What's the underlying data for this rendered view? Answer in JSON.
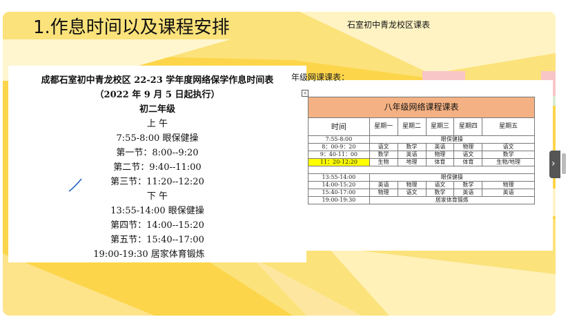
{
  "slide": {
    "title": "1.作息时间以及课程安排",
    "subtitle": "石室初中青龙校区课表"
  },
  "schedule": {
    "heading": "成都石室初中青龙校区 22-23 学年度网络保学作息时间表",
    "effective": "（2022 年 9 月 5 日起执行）",
    "grade": "初二年级",
    "morning": "上        午",
    "eye_exercise_am": "7:55-8:00 眼保健操",
    "period_1": "第一节：8:00--9:20",
    "period_2": "第二节：9:40--11:00",
    "period_3": "第三节：11:20--12:20",
    "afternoon": "下        午",
    "eye_exercise_pm": "13:55-14:00 眼保健操",
    "period_4": "第四节：14:00--15:20",
    "period_5": "第五节：15:40--17:00",
    "evening": "19:00-19:30        居家体育锻炼"
  },
  "timetable": {
    "section_label": "年级网课课表：",
    "title": "八年级网络课程课表",
    "header": [
      "时间",
      "星期一",
      "星期二",
      "星期三",
      "星期四",
      "星期五"
    ],
    "rows": [
      {
        "time": "7:55-8:00",
        "merged": "眼保健操"
      },
      {
        "time": "8：00-9：20",
        "cells": [
          "语文",
          "数学",
          "英语",
          "物理",
          "语文"
        ]
      },
      {
        "time": "9：40-11：00",
        "cells": [
          "数学",
          "英语",
          "物理",
          "语文",
          "数学"
        ]
      },
      {
        "time": "11：20-12:20",
        "cells": [
          "生物",
          "地理",
          "体育",
          "体育",
          "生物/地理"
        ]
      },
      {
        "time": "13:55-14:00",
        "merged": "眼保健操"
      },
      {
        "time": "14:00-15:20",
        "cells": [
          "英语",
          "物理",
          "语文",
          "数学",
          "物理"
        ]
      },
      {
        "time": "15:40-17:00",
        "cells": [
          "物理",
          "语文",
          "数学",
          "英语",
          "英语"
        ]
      },
      {
        "time": "19:00-19:30",
        "merged": "居家体育锻炼"
      }
    ]
  },
  "colors": {
    "slide_bg": "#fcd54a",
    "table_header": "#f4b183",
    "highlight": "#ffff00"
  }
}
